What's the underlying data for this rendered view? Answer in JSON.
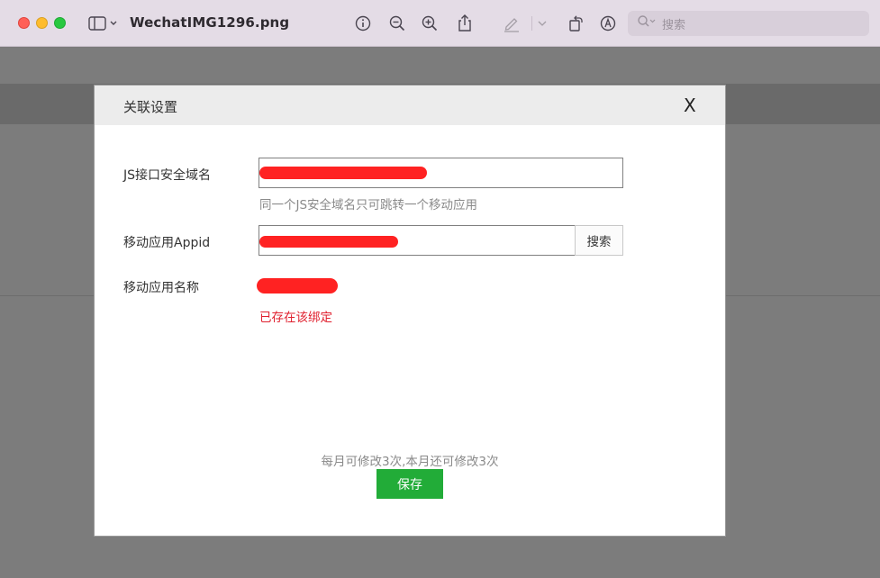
{
  "window": {
    "title": "WechatIMG1296.png",
    "search_placeholder": "搜索"
  },
  "toolbar": {
    "icons": [
      "sidebar-toggle-icon",
      "info-icon",
      "zoom-out-icon",
      "zoom-in-icon",
      "share-icon",
      "markup-pen-icon",
      "rotate-icon",
      "annotate-icon",
      "search-icon"
    ]
  },
  "modal": {
    "title": "关联设置",
    "close_label": "X",
    "js_domain_label": "JS接口安全域名",
    "js_domain_hint": "同一个JS安全域名只可跳转一个移动应用",
    "appid_label": "移动应用Appid",
    "search_button": "搜索",
    "app_name_label": "移动应用名称",
    "error_text": "已存在该绑定",
    "quota_text": "每月可修改3次,本月还可修改3次",
    "save_button": "保存"
  },
  "colors": {
    "save_green": "#22ac38",
    "error_red": "#e0212f",
    "redaction_red": "#ff2222"
  }
}
